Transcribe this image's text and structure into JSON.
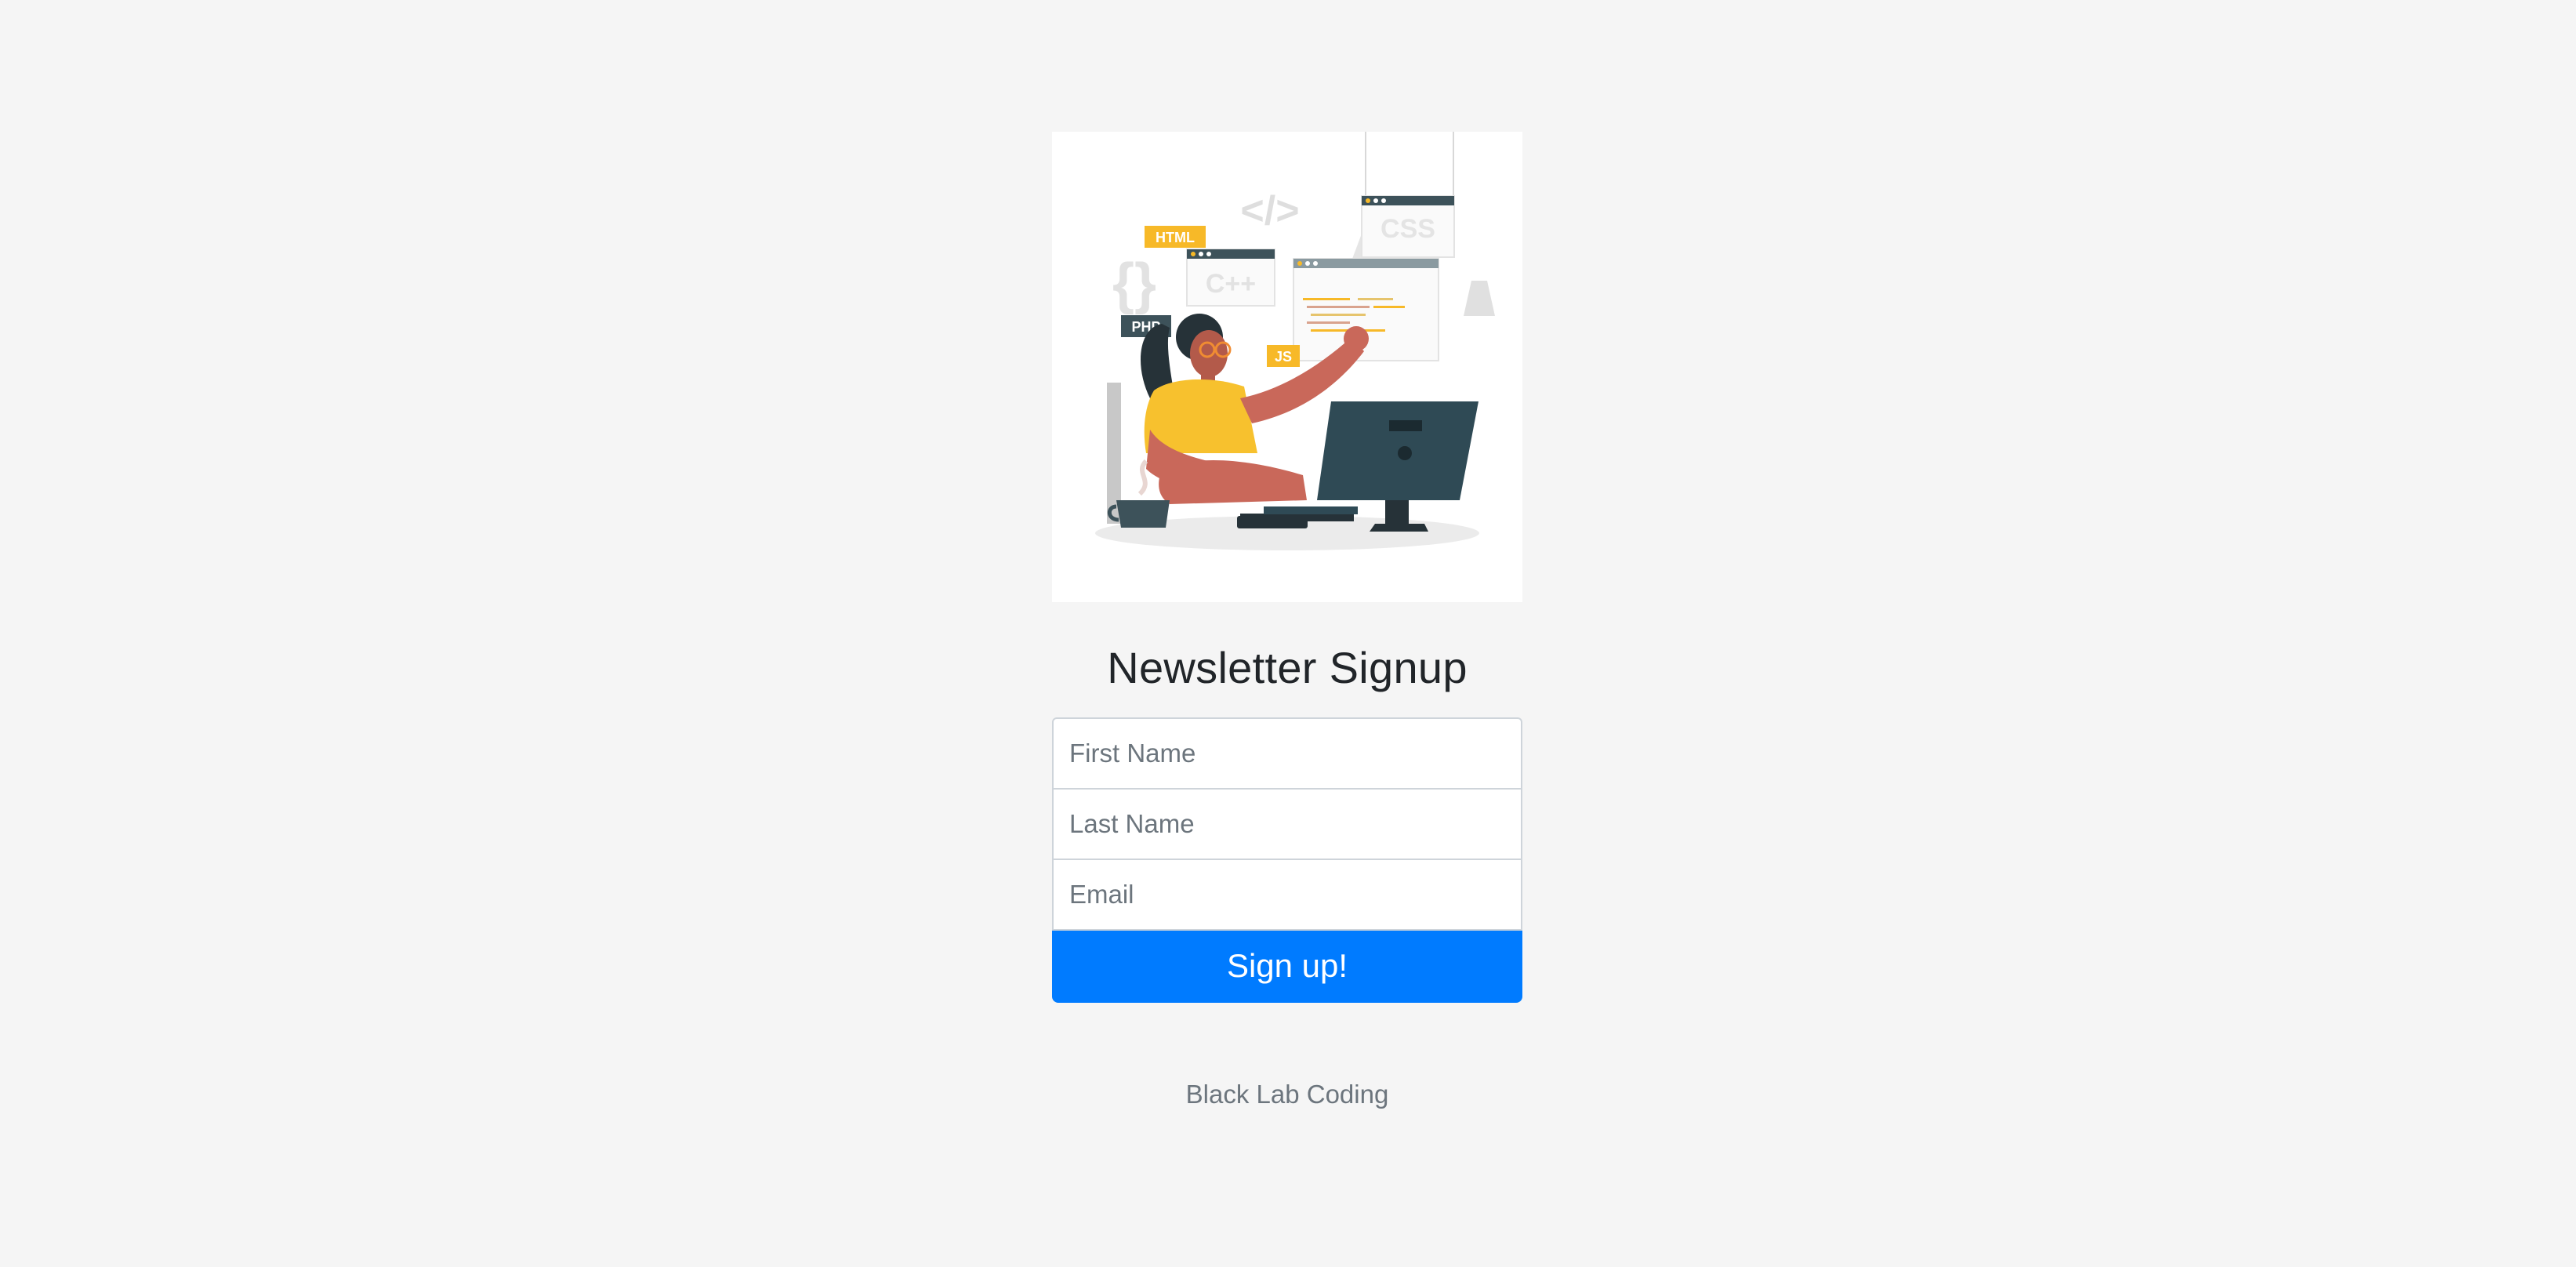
{
  "form": {
    "title": "Newsletter Signup",
    "first_name_placeholder": "First Name",
    "last_name_placeholder": "Last Name",
    "email_placeholder": "Email",
    "submit_label": "Sign up!"
  },
  "illustration": {
    "tags": {
      "html": "HTML",
      "cpp": "C++",
      "css": "CSS",
      "php": "PHP",
      "js": "JS",
      "code": "</>",
      "braces": "{}"
    }
  },
  "footer": {
    "text": "Black Lab Coding"
  },
  "colors": {
    "background": "#f5f5f5",
    "button": "#007bff",
    "accent_yellow": "#f7b928",
    "skin": "#c9685a",
    "dark_slate": "#2f4a55"
  }
}
